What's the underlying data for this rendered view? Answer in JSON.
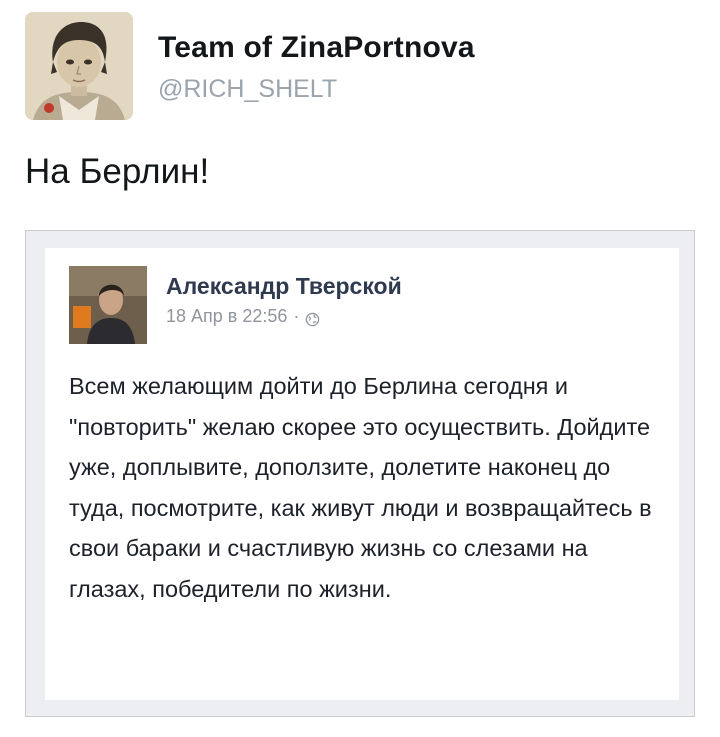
{
  "tweet": {
    "display_name": "Team of ZinaPortnova",
    "handle": "@RICH_SHELT",
    "text": "На Берлин!"
  },
  "embedded_post": {
    "author": "Александр Тверской",
    "date": "18 Апр в 22:56",
    "separator": "·",
    "privacy_icon": "globe-icon",
    "text": "Всем желающим дойти до Берлина сегодня и \"повторить\" желаю скорее это осуществить. Дойдите уже, доплывите, доползите, долетите наконец до туда, посмотрите, как живут люди и возвращайтесь в свои бараки и счастливую жизнь со слезами на глазах, победители по жизни."
  },
  "colors": {
    "handle": "#9aa4ad",
    "fb_name": "#2f3a4e",
    "fb_meta": "#90949c",
    "frame_border": "#c9ccd1",
    "frame_bg": "#eceef2"
  }
}
